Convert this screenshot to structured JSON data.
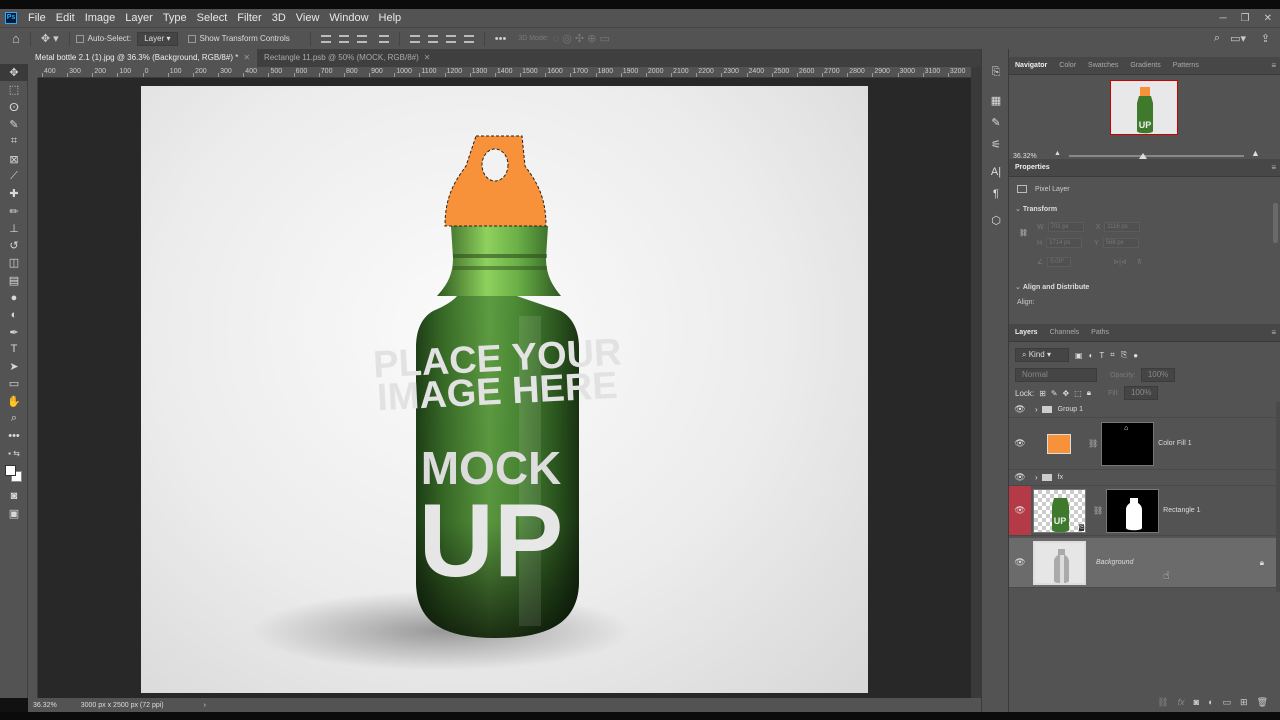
{
  "app": {
    "logo": "Ps"
  },
  "menu": [
    "File",
    "Edit",
    "Image",
    "Layer",
    "Type",
    "Select",
    "Filter",
    "3D",
    "View",
    "Window",
    "Help"
  ],
  "window_controls": {
    "minimize": "─",
    "restore": "❐",
    "close": "✕"
  },
  "options": {
    "auto_select_label": "Auto-Select:",
    "auto_select_target": "Layer",
    "show_transform_label": "Show Transform Controls",
    "more": "•••",
    "mode_3d_label": "3D Mode:"
  },
  "tabs": [
    {
      "label": "Metal bottle 2.1 (1).jpg @ 36.3% (Background, RGB/8#) *",
      "active": true
    },
    {
      "label": "Rectangle 11.psb @ 50% (MOCK, RGB/8#)",
      "active": false
    }
  ],
  "ruler_labels": [
    "400",
    "300",
    "200",
    "100",
    "0",
    "100",
    "200",
    "300",
    "400",
    "500",
    "600",
    "700",
    "800",
    "900",
    "1000",
    "1100",
    "1200",
    "1300",
    "1400",
    "1500",
    "1600",
    "1700",
    "1800",
    "1900",
    "2000",
    "2100",
    "2200",
    "2300",
    "2400",
    "2500",
    "2600",
    "2700",
    "2800",
    "2900",
    "3000",
    "3100",
    "3200"
  ],
  "canvas": {
    "line1": "PLACE YOUR",
    "line2": "IMAGE HERE",
    "mock": "MOCK",
    "up": "UP"
  },
  "status": {
    "zoom": "36.32%",
    "doc_info": "3000 px x 2500 px (72 ppi)",
    "arrow": "›"
  },
  "navigator": {
    "tabs": [
      "Navigator",
      "Color",
      "Swatches",
      "Gradients",
      "Patterns"
    ],
    "zoom": "36.32%",
    "thumb_text": "UP"
  },
  "properties": {
    "title": "Properties",
    "kind": "Pixel Layer",
    "transform_title": "Transform",
    "w_label": "W",
    "w_value": "701 px",
    "x_label": "X",
    "x_value": "1116 px",
    "h_label": "H",
    "h_value": "1714 px",
    "y_label": "Y",
    "y_value": "568 px",
    "angle_value": "0.00°",
    "align_title": "Align and Distribute",
    "align_label": "Align:"
  },
  "layers_panel": {
    "tabs": [
      "Layers",
      "Channels",
      "Paths"
    ],
    "filter_kind": "Kind",
    "blend_mode": "Normal",
    "opacity_label": "Opacity:",
    "opacity_value": "100%",
    "lock_label": "Lock:",
    "fill_label": "Fill:",
    "fill_value": "100%",
    "layers": [
      {
        "name": "Group 1",
        "type": "group"
      },
      {
        "name": "Color Fill 1",
        "type": "fill",
        "color": "#f7913a"
      },
      {
        "name": "fx",
        "type": "group"
      },
      {
        "name": "Rectangle 1",
        "type": "smart"
      },
      {
        "name": "Background",
        "type": "background"
      }
    ],
    "smart_thumb_text": "UP"
  },
  "colors": {
    "bg_panel": "#535353",
    "canvas_bg": "#282828",
    "orange_fill": "#f7913a",
    "bottle_green": "#3f7a2c",
    "selected_layer": "#b53a48"
  }
}
